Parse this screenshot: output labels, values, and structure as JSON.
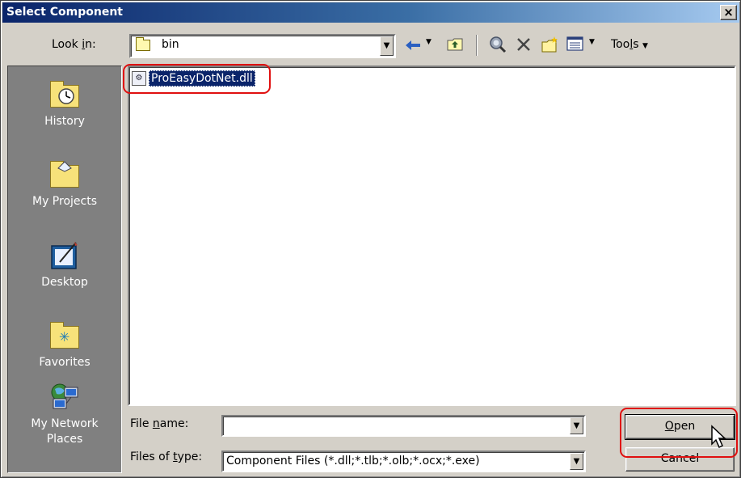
{
  "window": {
    "title": "Select Component",
    "close_glyph": "×"
  },
  "lookin": {
    "label_prefix": "Look ",
    "label_mnemonic": "i",
    "label_suffix": "n:",
    "value": "bin"
  },
  "toolbar": {
    "back_icon": "back-arrow-icon",
    "up_icon": "up-folder-icon",
    "search_web_icon": "search-web-icon",
    "delete_icon": "delete-icon",
    "new_folder_icon": "new-folder-icon",
    "views_icon": "views-icon",
    "tools_prefix": "Too",
    "tools_mnemonic": "l",
    "tools_suffix": "s"
  },
  "places": [
    {
      "label": "History",
      "icon": "history-icon"
    },
    {
      "label": "My Projects",
      "icon": "my-projects-icon"
    },
    {
      "label": "Desktop",
      "icon": "desktop-icon"
    },
    {
      "label": "Favorites",
      "icon": "favorites-icon"
    },
    {
      "label1": "My Network",
      "label2": "Places",
      "icon": "network-places-icon"
    }
  ],
  "files": [
    {
      "name": "ProEasyDotNet.dll",
      "selected": true
    }
  ],
  "filename": {
    "label_prefix": "File ",
    "label_mnemonic": "n",
    "label_suffix": "ame:",
    "value": ""
  },
  "filetype": {
    "label_prefix": "Files of ",
    "label_mnemonic": "t",
    "label_suffix": "ype:",
    "value": "Component Files (*.dll;*.tlb;*.olb;*.ocx;*.exe)"
  },
  "buttons": {
    "open_mnemonic": "O",
    "open_rest": "pen",
    "cancel": "Cancel"
  },
  "colors": {
    "title_gradient_start": "#0a246a",
    "selection": "#0a246a",
    "highlight_ring": "#e01010",
    "dialog_face": "#d4d0c8"
  }
}
